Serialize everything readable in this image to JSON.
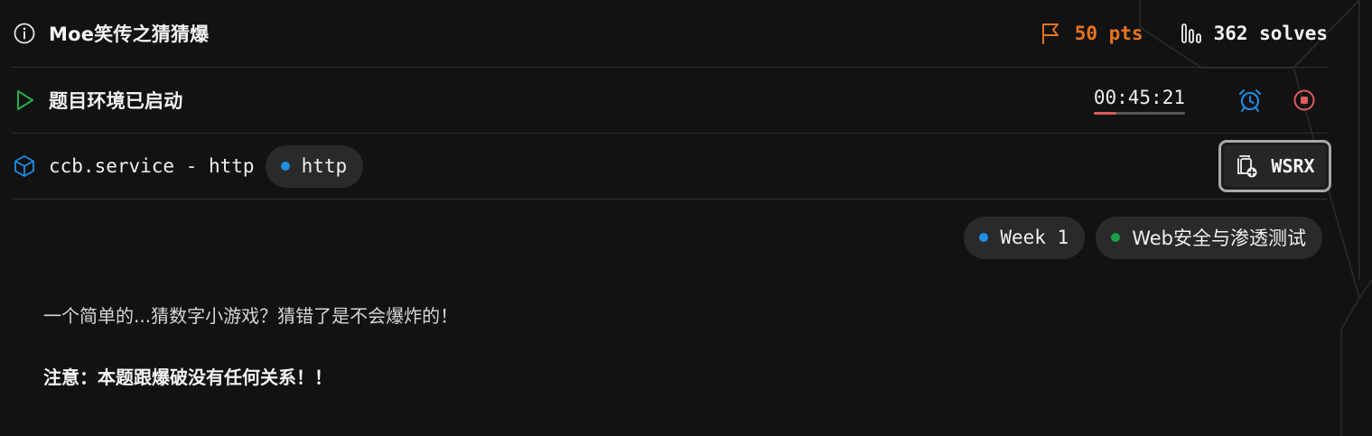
{
  "challenge": {
    "title": "Moe笑传之猜猜爆",
    "points": "50 pts",
    "solves": "362 solves"
  },
  "environment": {
    "status": "题目环境已启动",
    "timer": "00:45:21",
    "timer_progress": 0.25
  },
  "service": {
    "name": "ccb.service - http",
    "protocol": "http",
    "wsrx_label": "WSRX"
  },
  "tags": [
    {
      "label": "Week 1",
      "color": "#1e8fe6"
    },
    {
      "label": "Web安全与渗透测试",
      "color": "#17a34a"
    }
  ],
  "description": {
    "line1": "一个简单的...猜数字小游戏？猜错了是不会爆炸的！",
    "note": "注意：本题跟爆破没有任何关系！！"
  },
  "colors": {
    "accent_orange": "#e8741d",
    "play_green": "#22b14c",
    "alarm_blue": "#1e8fe6",
    "stop_red": "#e05a5a"
  },
  "icons": {
    "info": "info-icon",
    "flag": "flag-icon",
    "solves": "bar-chart-icon",
    "play": "play-icon",
    "alarm": "alarm-clock-icon",
    "stop": "stop-icon",
    "service": "cube-icon",
    "wsrx": "copy-plus-icon"
  }
}
